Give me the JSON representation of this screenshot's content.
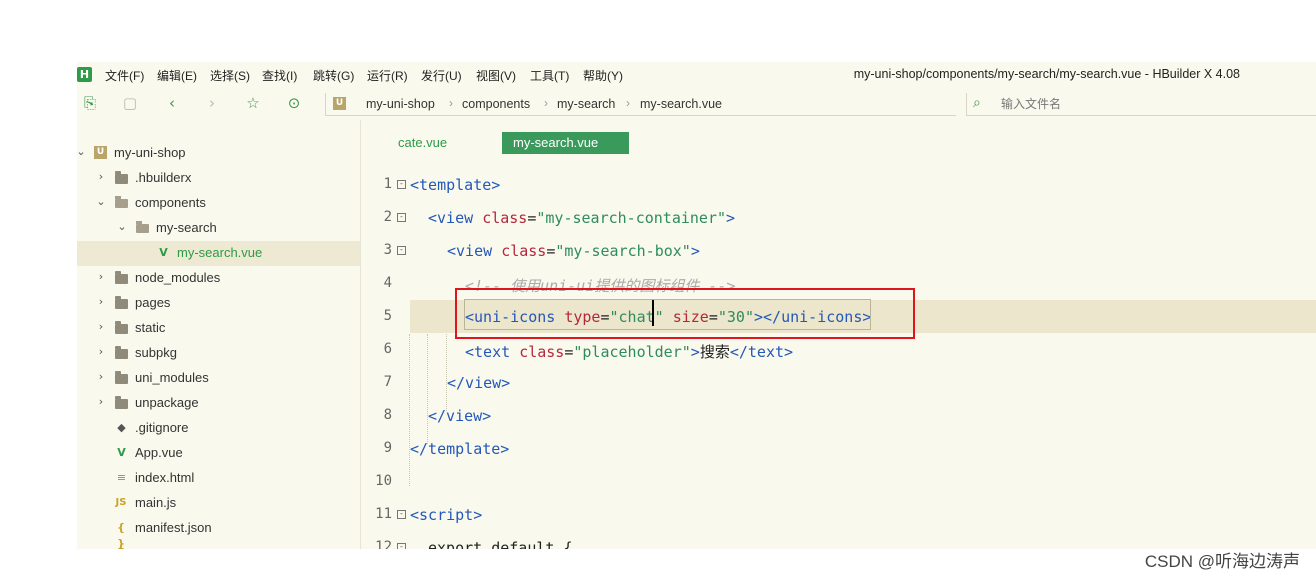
{
  "menubar": {
    "logo": "H",
    "items": [
      "文件(F)",
      "编辑(E)",
      "选择(S)",
      "查找(I)",
      "跳转(G)",
      "运行(R)",
      "发行(U)",
      "视图(V)",
      "工具(T)",
      "帮助(Y)"
    ],
    "window_title": "my-uni-shop/components/my-search/my-search.vue - HBuilder X 4.08"
  },
  "toolbar": {
    "breadcrumb": [
      "my-uni-shop",
      "components",
      "my-search",
      "my-search.vue"
    ],
    "search_placeholder": "输入文件名"
  },
  "sidebar": {
    "items": [
      {
        "label": "my-uni-shop",
        "icon": "project-icon",
        "expanded": true
      },
      {
        "label": ".hbuilderx",
        "icon": "folder-icon"
      },
      {
        "label": "components",
        "icon": "folder-open-icon",
        "expanded": true
      },
      {
        "label": "my-search",
        "icon": "folder-open-icon",
        "expanded": true
      },
      {
        "label": "my-search.vue",
        "icon": "vue-file-icon",
        "selected": true
      },
      {
        "label": "node_modules",
        "icon": "folder-icon"
      },
      {
        "label": "pages",
        "icon": "folder-icon"
      },
      {
        "label": "static",
        "icon": "folder-icon"
      },
      {
        "label": "subpkg",
        "icon": "folder-icon"
      },
      {
        "label": "uni_modules",
        "icon": "folder-icon"
      },
      {
        "label": "unpackage",
        "icon": "folder-icon"
      },
      {
        "label": ".gitignore",
        "icon": "git-file-icon"
      },
      {
        "label": "App.vue",
        "icon": "vue-file-icon"
      },
      {
        "label": "index.html",
        "icon": "html-file-icon"
      },
      {
        "label": "main.js",
        "icon": "js-file-icon"
      },
      {
        "label": "manifest.json",
        "icon": "json-file-icon"
      }
    ]
  },
  "editor": {
    "tabs": [
      {
        "label": "cate.vue",
        "active": false
      },
      {
        "label": "my-search.vue",
        "active": true
      }
    ],
    "lines": [
      {
        "n": "1",
        "fold": true,
        "tokens": [
          [
            "tag",
            "<template>"
          ]
        ]
      },
      {
        "n": "2",
        "fold": true,
        "tokens": [
          [
            "tag",
            "<view "
          ],
          [
            "attr",
            "class"
          ],
          [
            "txt",
            "="
          ],
          [
            "str",
            "\"my-search-container\""
          ],
          [
            "tag",
            ">"
          ]
        ]
      },
      {
        "n": "3",
        "fold": true,
        "tokens": [
          [
            "tag",
            "<view "
          ],
          [
            "attr",
            "class"
          ],
          [
            "txt",
            "="
          ],
          [
            "str",
            "\"my-search-box\""
          ],
          [
            "tag",
            ">"
          ]
        ]
      },
      {
        "n": "4",
        "fold": false,
        "tokens": [
          [
            "cmt",
            "<!-- 使用uni-ui提供的图标组件 -->"
          ]
        ]
      },
      {
        "n": "5",
        "fold": false,
        "tokens": [
          [
            "tag",
            "<uni-icons "
          ],
          [
            "attr",
            "type"
          ],
          [
            "txt",
            "="
          ],
          [
            "str",
            "\"chat\""
          ],
          [
            "txt",
            " "
          ],
          [
            "attr",
            "size"
          ],
          [
            "txt",
            "="
          ],
          [
            "str",
            "\"30\""
          ],
          [
            "tag",
            "></uni-icons>"
          ]
        ]
      },
      {
        "n": "6",
        "fold": false,
        "tokens": [
          [
            "tag",
            "<text "
          ],
          [
            "attr",
            "class"
          ],
          [
            "txt",
            "="
          ],
          [
            "str",
            "\"placeholder\""
          ],
          [
            "tag",
            ">"
          ],
          [
            "txt",
            "搜索"
          ],
          [
            "tag",
            "</text>"
          ]
        ]
      },
      {
        "n": "7",
        "fold": false,
        "tokens": [
          [
            "tag",
            "</view>"
          ]
        ]
      },
      {
        "n": "8",
        "fold": false,
        "tokens": [
          [
            "tag",
            "</view>"
          ]
        ]
      },
      {
        "n": "9",
        "fold": false,
        "tokens": [
          [
            "tag",
            "</template>"
          ]
        ]
      },
      {
        "n": "10",
        "fold": false,
        "tokens": []
      },
      {
        "n": "11",
        "fold": true,
        "tokens": [
          [
            "tag",
            "<script>"
          ]
        ]
      },
      {
        "n": "12",
        "fold": true,
        "tokens": [
          [
            "kw",
            "export default {"
          ]
        ]
      }
    ]
  },
  "watermark": "CSDN @听海边涛声"
}
